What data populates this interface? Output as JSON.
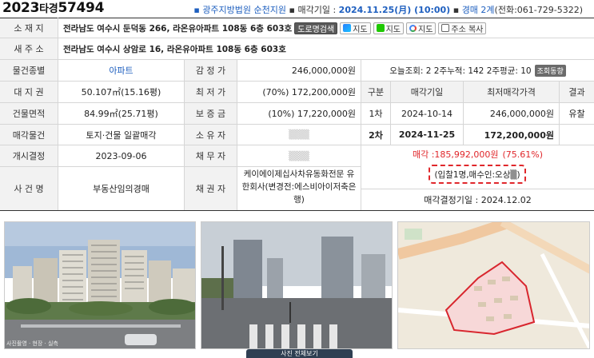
{
  "header": {
    "case_year": "2023",
    "case_type": "타경",
    "case_number": "57494",
    "court": "광주지방법원 순천지원",
    "auction_date_label": "매각기일 :",
    "auction_date": "2024.11.25(月) (10:00)",
    "dept": "경매 2계",
    "tel": "(전화:061-729-5322)",
    "bullet": "▪"
  },
  "labels": {
    "location": "소 재 지",
    "new_address": "새 주 소",
    "property_type": "물건종별",
    "land_rights": "대 지 권",
    "building_area": "건물면적",
    "sale_object": "매각물건",
    "start_decision": "개시결정",
    "case_name": "사 건 명",
    "appraised_price": "감 정 가",
    "minimum_price": "최 저 가",
    "deposit": "보 증 금",
    "owner": "소 유 자",
    "debtor": "채 무 자",
    "creditor": "채 권 자"
  },
  "property": {
    "address": "전라남도 여수시 둔덕동 266, 라온유아파트 108동 6층 603호",
    "new_address": "전라남도 여수시 상암로 16, 라온유아파트 108동 6층 603호",
    "type": "아파트",
    "land_rights": "50.107㎡(15.16평)",
    "building_area": "84.99㎡(25.71평)",
    "sale_object": "토지·건물 일괄매각",
    "start_decision": "2023-09-06",
    "case_name": "부동산임의경매",
    "appraised_price": "246,000,000원",
    "minimum_price": "(70%) 172,200,000원",
    "deposit": "(10%) 17,220,000원",
    "owner": "▒▒▒",
    "debtor": "▒▒▒",
    "creditor_line1": "케이에이제십사차유동화전문 유",
    "creditor_line2": "한회사(변경전:에스비아이저축은",
    "creditor_line3": "행)"
  },
  "buttons": {
    "road_search": "도로명검색",
    "map1": "지도",
    "map2": "지도",
    "map3": "지도",
    "copy_address": "주소 복사",
    "view_stats": "조회동향"
  },
  "stats": {
    "text": "오늘조회: 2  2주누적: 142  2주평균: 10"
  },
  "history": {
    "headers": [
      "구분",
      "매각기일",
      "최저매각가격",
      "결과"
    ],
    "rows": [
      {
        "round": "1차",
        "date": "2024-10-14",
        "price": "246,000,000원",
        "result": "유찰"
      },
      {
        "round": "2차",
        "date": "2024-11-25",
        "price": "172,200,000원",
        "result": ""
      }
    ],
    "sale_label": "매각 : ",
    "sale_price": "185,992,000원",
    "sale_ratio": "(75.61%)",
    "bid_info": "(입찰1명,매수인:오상▒)",
    "decision": "매각결정기일 : 2024.12.02"
  },
  "photos": {
    "caption1": "사진촬영 · 현장 · 실측",
    "view_button": "사진 전체보기"
  }
}
